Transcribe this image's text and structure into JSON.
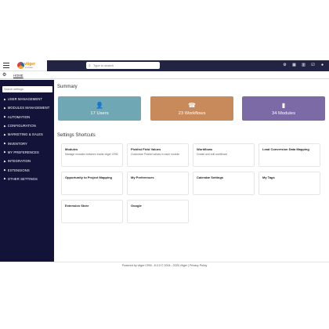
{
  "topbar": {
    "logo_word": "vtiger",
    "logo_sub": "innovate",
    "search_placeholder": "Type to search",
    "icons": [
      "gear-icon",
      "calendar-icon",
      "chart-icon",
      "checkbox-icon",
      "user-icon"
    ]
  },
  "subbar": {
    "home_label": "HOME"
  },
  "sidebar": {
    "search_placeholder": "Search settings",
    "items": [
      {
        "label": "USER MANAGEMENT"
      },
      {
        "label": "MODULES MANAGEMENT"
      },
      {
        "label": "AUTOMATION"
      },
      {
        "label": "CONFIGURATION"
      },
      {
        "label": "MARKETING & SALES"
      },
      {
        "label": "INVENTORY"
      },
      {
        "label": "MY PREFERENCES"
      },
      {
        "label": "INTEGRATION"
      },
      {
        "label": "EXTENSIONS"
      },
      {
        "label": "OTHER SETTINGS"
      }
    ],
    "caret": "▶"
  },
  "summary": {
    "title": "Summary",
    "cards": [
      {
        "icon": "user-icon",
        "label": "17 Users",
        "color": "#6fa7b4"
      },
      {
        "icon": "phone-icon",
        "label": "23  Workflows",
        "color": "#c88a5a"
      },
      {
        "icon": "file-icon",
        "label": "34 Modules",
        "color": "#7b6aa6"
      }
    ]
  },
  "shortcuts": {
    "title": "Settings Shortcuts",
    "tiles": [
      {
        "name": "Modules",
        "desc": "Manage modules between inside vtiger CRM"
      },
      {
        "name": "Picklist Field Values",
        "desc": "Customize Picklist values in each module"
      },
      {
        "name": "Workflows",
        "desc": "Create and edit workflows"
      },
      {
        "name": "Lead Conversion Data Mapping",
        "desc": ""
      },
      {
        "name": "Opportunity to Project Mapping",
        "desc": ""
      },
      {
        "name": "My Preferences",
        "desc": ""
      },
      {
        "name": "Calendar Settings",
        "desc": ""
      },
      {
        "name": "My Tags",
        "desc": ""
      },
      {
        "name": "Extension Store",
        "desc": ""
      },
      {
        "name": "Google",
        "desc": ""
      }
    ]
  },
  "footer": {
    "text": "Powered by vtiger CRM - 8.0.0  © 2004 - 2025  Vtiger  |  Privacy Policy"
  }
}
